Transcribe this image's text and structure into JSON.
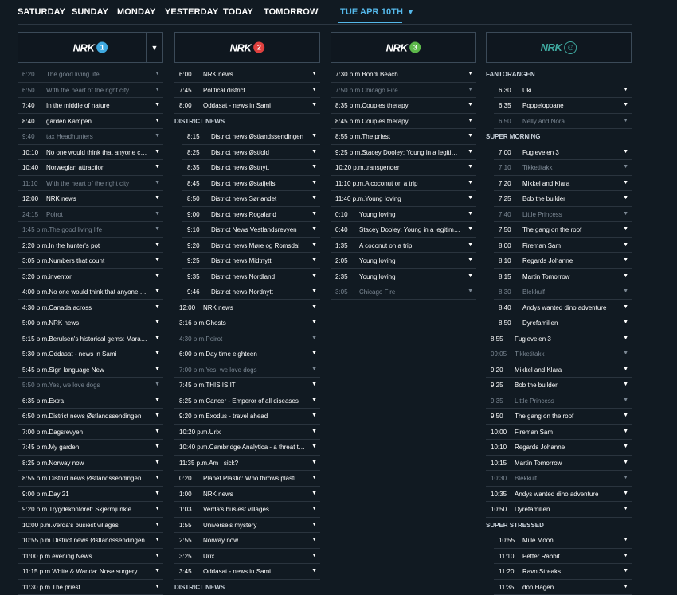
{
  "nav": {
    "days": [
      "SATURDAY",
      "SUNDAY",
      "MONDAY",
      "YESTERDAY",
      "TODAY",
      "TOMORROW"
    ],
    "active": "TUE APR 10TH"
  },
  "accent": "#55b8ea",
  "channels": [
    {
      "brand": "NRK",
      "num": "1",
      "color": "#3fa9e0",
      "dropdown": true,
      "programs": [
        {
          "time": "6:20",
          "title": "The good living life",
          "dim": true
        },
        {
          "time": "6:50",
          "title": "With the heart of the right city",
          "dim": true
        },
        {
          "time": "7:40",
          "title": "In the middle of nature"
        },
        {
          "time": "8:40",
          "title": "garden Kampen"
        },
        {
          "time": "9:40",
          "title": "tax Headhunters",
          "dim": true
        },
        {
          "time": "10:10",
          "title": "No one would think that anyone cou..."
        },
        {
          "time": "10:40",
          "title": "Norwegian attraction"
        },
        {
          "time": "11:10",
          "title": "With the heart of the right city",
          "dim": true
        },
        {
          "time": "12:00",
          "title": "NRK news"
        },
        {
          "time": "24:15",
          "title": "Poirot",
          "dim": true
        },
        {
          "full": "1:45 p.m.The good living life",
          "dim": true
        },
        {
          "full": "2:20 p.m.In the hunter's pot"
        },
        {
          "full": "3:05 p.m.Numbers that count"
        },
        {
          "full": "3:20 p.m.inventor"
        },
        {
          "full": "4:00 p.m.No one would think that anyone co..."
        },
        {
          "full": "4:30 p.m.Canada across"
        },
        {
          "full": "5:00 p.m.NRK news"
        },
        {
          "full": "5:15 p.m.Berulsen's historical gems: Marathon"
        },
        {
          "full": "5:30 p.m.Oddasat - news in Sami"
        },
        {
          "full": "5:45 p.m.Sign language New"
        },
        {
          "full": "5:50 p.m.Yes, we love dogs",
          "dim": true
        },
        {
          "full": "6:35 p.m.Extra"
        },
        {
          "full": "6:50 p.m.District news Østlandssendingen"
        },
        {
          "full": "7:00 p.m.Dagsrevyen"
        },
        {
          "full": "7:45 p.m.My garden"
        },
        {
          "full": "8:25 p.m.Norway now"
        },
        {
          "full": "8:55 p.m.District news Østlandssendingen"
        },
        {
          "full": "9:00 p.m.Day 21"
        },
        {
          "full": "9:20 p.m.Trygdekontoret: Skjermjunkie"
        },
        {
          "full": "10:00 p.m.Verda's busiest villages"
        },
        {
          "full": "10:55 p.m.District news Østlandssendingen"
        },
        {
          "full": "11:00 p.m.evening News"
        },
        {
          "full": "11:15 p.m.White & Wanda: Nose surgery"
        },
        {
          "full": "11:30 p.m.The priest"
        }
      ]
    },
    {
      "brand": "NRK",
      "num": "2",
      "color": "#e0413f",
      "dropdown": false,
      "programs": [
        {
          "time": "6:00",
          "title": "NRK news"
        },
        {
          "time": "7:45",
          "title": "Political district"
        },
        {
          "time": "8:00",
          "title": "Oddasat - news in Sami"
        },
        {
          "section": "DISTRICT NEWS"
        },
        {
          "time": "8:15",
          "title": "District news Østlandssendingen",
          "indent": true
        },
        {
          "time": "8:25",
          "title": "District news Østfold",
          "indent": true
        },
        {
          "time": "8:35",
          "title": "District news Østnytt",
          "indent": true
        },
        {
          "time": "8:45",
          "title": "District news Østafjells",
          "indent": true
        },
        {
          "time": "8:50",
          "title": "District news Sørlandet",
          "indent": true
        },
        {
          "time": "9:00",
          "title": "District news Rogaland",
          "indent": true
        },
        {
          "time": "9:10",
          "title": "District News Vestlandsrevyen",
          "indent": true
        },
        {
          "time": "9:20",
          "title": "District news Møre og Romsdal",
          "indent": true
        },
        {
          "time": "9:25",
          "title": "District news Midtnytt",
          "indent": true
        },
        {
          "time": "9:35",
          "title": "District news Nordland",
          "indent": true
        },
        {
          "time": "9:46",
          "title": "District news Nordnytt",
          "indent": true
        },
        {
          "time": "12:00",
          "title": "NRK news"
        },
        {
          "full": "3:16 p.m.Ghosts"
        },
        {
          "full": "4:30 p.m.Poirot",
          "dim": true
        },
        {
          "full": "6:00 p.m.Day time eighteen"
        },
        {
          "full": "7:00 p.m.Yes, we love dogs",
          "dim": true
        },
        {
          "full": "7:45 p.m.THIS IS IT"
        },
        {
          "full": "8:25 p.m.Cancer - Emperor of all diseases"
        },
        {
          "full": "9:20 p.m.Exodus - travel ahead"
        },
        {
          "full": "10:20 p.m.Urix"
        },
        {
          "full": "10:40 p.m.Cambridge Analytica - a threat to d..."
        },
        {
          "full": "11:35 p.m.Am I sick?"
        },
        {
          "time": "0:20",
          "title": "Planet Plastic: Who throws plastic in..."
        },
        {
          "time": "1:00",
          "title": "NRK news"
        },
        {
          "time": "1:03",
          "title": "Verda's busiest villages"
        },
        {
          "time": "1:55",
          "title": "Universe's mystery"
        },
        {
          "time": "2:55",
          "title": "Norway now"
        },
        {
          "time": "3:25",
          "title": "Urix"
        },
        {
          "time": "3:45",
          "title": "Oddasat - news in Sami"
        },
        {
          "section": "DISTRICT NEWS"
        }
      ]
    },
    {
      "brand": "NRK",
      "num": "3",
      "color": "#5cb84a",
      "dropdown": false,
      "programs": [
        {
          "full": "7:30 p.m.Bondi Beach"
        },
        {
          "full": "7:50 p.m.Chicago Fire",
          "dim": true
        },
        {
          "full": "8:35 p.m.Couples therapy"
        },
        {
          "full": "8:45 p.m.Couples therapy"
        },
        {
          "full": "8:55 p.m.The priest"
        },
        {
          "full": "9:25 p.m.Stacey Dooley: Young in a legitimat..."
        },
        {
          "full": "10:20 p.m.transgender"
        },
        {
          "full": "11:10 p.m.A coconut on a trip"
        },
        {
          "full": "11:40 p.m.Young loving"
        },
        {
          "time": "0:10",
          "title": "Young loving"
        },
        {
          "time": "0:40",
          "title": "Stacey Dooley: Young in a legitimat..."
        },
        {
          "time": "1:35",
          "title": "A coconut on a trip"
        },
        {
          "time": "2:05",
          "title": "Young loving"
        },
        {
          "time": "2:35",
          "title": "Young loving"
        },
        {
          "time": "3:05",
          "title": "Chicago Fire",
          "dim": true
        }
      ]
    },
    {
      "brand": "NRK",
      "num": "super",
      "color": "#3fa9a0",
      "dropdown": false,
      "programs": [
        {
          "section": "FANTORANGEN"
        },
        {
          "time": "6:30",
          "title": "Uki",
          "indent": true
        },
        {
          "time": "6:35",
          "title": "Poppeloppane",
          "indent": true
        },
        {
          "time": "6:50",
          "title": "Nelly and Nora",
          "indent": true,
          "dim": true
        },
        {
          "section": "SUPER MORNING"
        },
        {
          "time": "7:00",
          "title": "Fugleveien 3",
          "indent": true
        },
        {
          "time": "7:10",
          "title": "Tikketitakk",
          "indent": true,
          "dim": true
        },
        {
          "time": "7:20",
          "title": "Mikkel and Klara",
          "indent": true
        },
        {
          "time": "7:25",
          "title": "Bob the builder",
          "indent": true
        },
        {
          "time": "7:40",
          "title": "Little Princess",
          "indent": true,
          "dim": true
        },
        {
          "time": "7:50",
          "title": "The gang on the roof",
          "indent": true
        },
        {
          "time": "8:00",
          "title": "Fireman Sam",
          "indent": true
        },
        {
          "time": "8:10",
          "title": "Regards Johanne",
          "indent": true
        },
        {
          "time": "8:15",
          "title": "Martin Tomorrow",
          "indent": true
        },
        {
          "time": "8:30",
          "title": "Blekkulf",
          "indent": true,
          "dim": true
        },
        {
          "time": "8:40",
          "title": "Andys wanted dino adventure",
          "indent": true
        },
        {
          "time": "8:50",
          "title": "Dyrefamilien",
          "indent": true
        },
        {
          "time": "8:55",
          "title": "Fugleveien 3"
        },
        {
          "time": "09:05",
          "title": "Tikketitakk",
          "dim": true
        },
        {
          "time": "9:20",
          "title": "Mikkel and Klara"
        },
        {
          "time": "9:25",
          "title": "Bob the builder"
        },
        {
          "time": "9:35",
          "title": "Little Princess",
          "dim": true
        },
        {
          "time": "9:50",
          "title": "The gang on the roof"
        },
        {
          "time": "10:00",
          "title": "Fireman Sam"
        },
        {
          "time": "10:10",
          "title": "Regards Johanne"
        },
        {
          "time": "10:15",
          "title": "Martin Tomorrow"
        },
        {
          "time": "10:30",
          "title": "Blekkulf",
          "dim": true
        },
        {
          "time": "10:35",
          "title": "Andys wanted dino adventure"
        },
        {
          "time": "10:50",
          "title": "Dyrefamilien"
        },
        {
          "section": "SUPER STRESSED"
        },
        {
          "time": "10:55",
          "title": "Mille Moon",
          "indent": true
        },
        {
          "time": "11:10",
          "title": "Petter Rabbit",
          "indent": true
        },
        {
          "time": "11:20",
          "title": "Ravn Streaks",
          "indent": true
        },
        {
          "time": "11:35",
          "title": "don Hagen",
          "indent": true
        }
      ]
    }
  ]
}
